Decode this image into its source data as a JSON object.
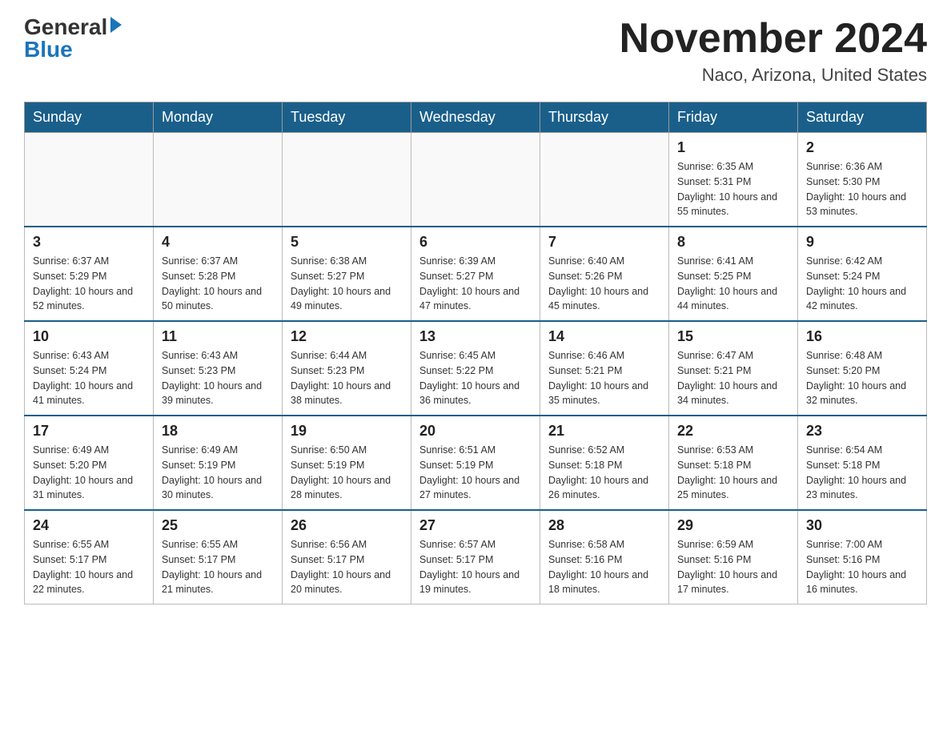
{
  "logo": {
    "general": "General",
    "blue": "Blue"
  },
  "header": {
    "month": "November 2024",
    "location": "Naco, Arizona, United States"
  },
  "weekdays": [
    "Sunday",
    "Monday",
    "Tuesday",
    "Wednesday",
    "Thursday",
    "Friday",
    "Saturday"
  ],
  "weeks": [
    [
      {
        "day": "",
        "info": ""
      },
      {
        "day": "",
        "info": ""
      },
      {
        "day": "",
        "info": ""
      },
      {
        "day": "",
        "info": ""
      },
      {
        "day": "",
        "info": ""
      },
      {
        "day": "1",
        "info": "Sunrise: 6:35 AM\nSunset: 5:31 PM\nDaylight: 10 hours and 55 minutes."
      },
      {
        "day": "2",
        "info": "Sunrise: 6:36 AM\nSunset: 5:30 PM\nDaylight: 10 hours and 53 minutes."
      }
    ],
    [
      {
        "day": "3",
        "info": "Sunrise: 6:37 AM\nSunset: 5:29 PM\nDaylight: 10 hours and 52 minutes."
      },
      {
        "day": "4",
        "info": "Sunrise: 6:37 AM\nSunset: 5:28 PM\nDaylight: 10 hours and 50 minutes."
      },
      {
        "day": "5",
        "info": "Sunrise: 6:38 AM\nSunset: 5:27 PM\nDaylight: 10 hours and 49 minutes."
      },
      {
        "day": "6",
        "info": "Sunrise: 6:39 AM\nSunset: 5:27 PM\nDaylight: 10 hours and 47 minutes."
      },
      {
        "day": "7",
        "info": "Sunrise: 6:40 AM\nSunset: 5:26 PM\nDaylight: 10 hours and 45 minutes."
      },
      {
        "day": "8",
        "info": "Sunrise: 6:41 AM\nSunset: 5:25 PM\nDaylight: 10 hours and 44 minutes."
      },
      {
        "day": "9",
        "info": "Sunrise: 6:42 AM\nSunset: 5:24 PM\nDaylight: 10 hours and 42 minutes."
      }
    ],
    [
      {
        "day": "10",
        "info": "Sunrise: 6:43 AM\nSunset: 5:24 PM\nDaylight: 10 hours and 41 minutes."
      },
      {
        "day": "11",
        "info": "Sunrise: 6:43 AM\nSunset: 5:23 PM\nDaylight: 10 hours and 39 minutes."
      },
      {
        "day": "12",
        "info": "Sunrise: 6:44 AM\nSunset: 5:23 PM\nDaylight: 10 hours and 38 minutes."
      },
      {
        "day": "13",
        "info": "Sunrise: 6:45 AM\nSunset: 5:22 PM\nDaylight: 10 hours and 36 minutes."
      },
      {
        "day": "14",
        "info": "Sunrise: 6:46 AM\nSunset: 5:21 PM\nDaylight: 10 hours and 35 minutes."
      },
      {
        "day": "15",
        "info": "Sunrise: 6:47 AM\nSunset: 5:21 PM\nDaylight: 10 hours and 34 minutes."
      },
      {
        "day": "16",
        "info": "Sunrise: 6:48 AM\nSunset: 5:20 PM\nDaylight: 10 hours and 32 minutes."
      }
    ],
    [
      {
        "day": "17",
        "info": "Sunrise: 6:49 AM\nSunset: 5:20 PM\nDaylight: 10 hours and 31 minutes."
      },
      {
        "day": "18",
        "info": "Sunrise: 6:49 AM\nSunset: 5:19 PM\nDaylight: 10 hours and 30 minutes."
      },
      {
        "day": "19",
        "info": "Sunrise: 6:50 AM\nSunset: 5:19 PM\nDaylight: 10 hours and 28 minutes."
      },
      {
        "day": "20",
        "info": "Sunrise: 6:51 AM\nSunset: 5:19 PM\nDaylight: 10 hours and 27 minutes."
      },
      {
        "day": "21",
        "info": "Sunrise: 6:52 AM\nSunset: 5:18 PM\nDaylight: 10 hours and 26 minutes."
      },
      {
        "day": "22",
        "info": "Sunrise: 6:53 AM\nSunset: 5:18 PM\nDaylight: 10 hours and 25 minutes."
      },
      {
        "day": "23",
        "info": "Sunrise: 6:54 AM\nSunset: 5:18 PM\nDaylight: 10 hours and 23 minutes."
      }
    ],
    [
      {
        "day": "24",
        "info": "Sunrise: 6:55 AM\nSunset: 5:17 PM\nDaylight: 10 hours and 22 minutes."
      },
      {
        "day": "25",
        "info": "Sunrise: 6:55 AM\nSunset: 5:17 PM\nDaylight: 10 hours and 21 minutes."
      },
      {
        "day": "26",
        "info": "Sunrise: 6:56 AM\nSunset: 5:17 PM\nDaylight: 10 hours and 20 minutes."
      },
      {
        "day": "27",
        "info": "Sunrise: 6:57 AM\nSunset: 5:17 PM\nDaylight: 10 hours and 19 minutes."
      },
      {
        "day": "28",
        "info": "Sunrise: 6:58 AM\nSunset: 5:16 PM\nDaylight: 10 hours and 18 minutes."
      },
      {
        "day": "29",
        "info": "Sunrise: 6:59 AM\nSunset: 5:16 PM\nDaylight: 10 hours and 17 minutes."
      },
      {
        "day": "30",
        "info": "Sunrise: 7:00 AM\nSunset: 5:16 PM\nDaylight: 10 hours and 16 minutes."
      }
    ]
  ]
}
